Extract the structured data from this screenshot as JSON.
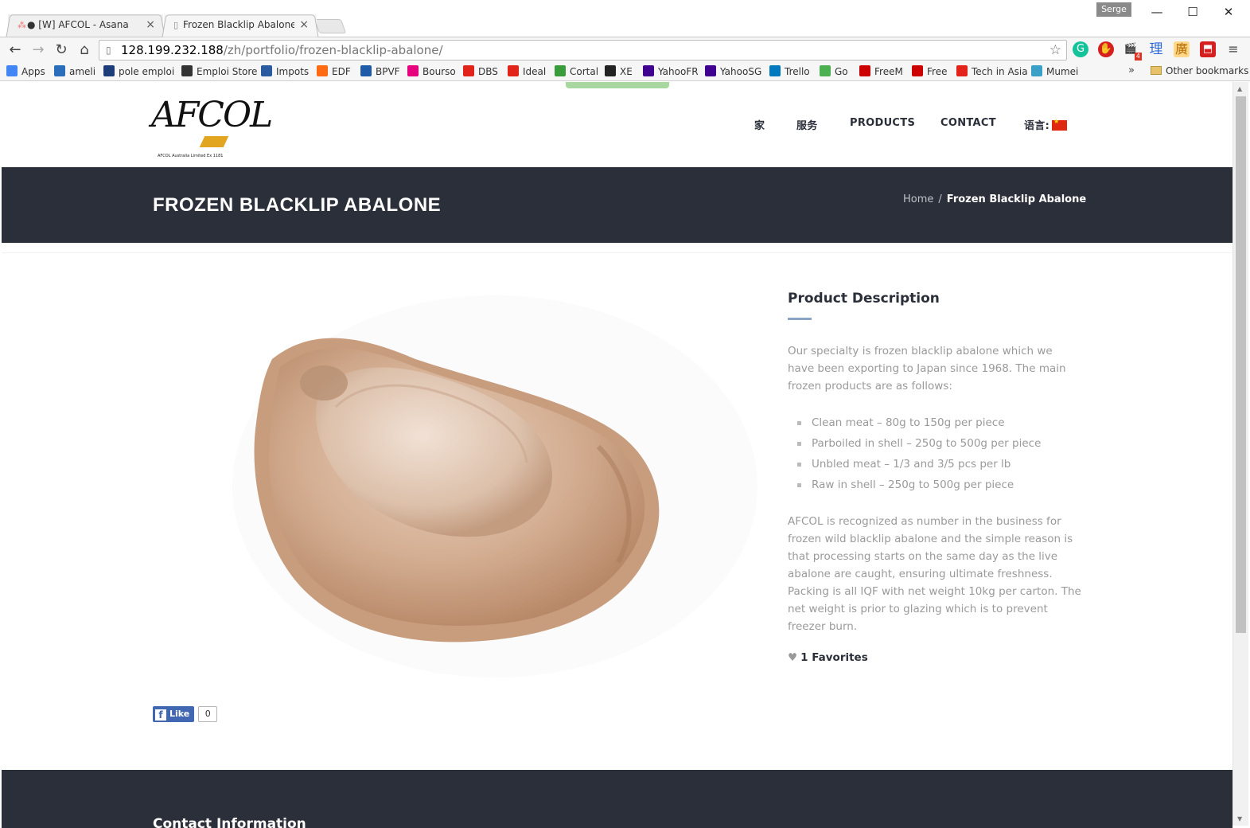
{
  "tabs": [
    {
      "title": "● [W] AFCOL - Asana",
      "icon": "asana-icon"
    },
    {
      "title": "Frozen Blacklip Abalone | A",
      "icon": "page-icon"
    }
  ],
  "window": {
    "profile": "Serge"
  },
  "address": {
    "host": "128.199.232.188",
    "path": "/zh/portfolio/frozen-blacklip-abalone/"
  },
  "extensions": {
    "clap_badge": "4",
    "li": "理",
    "guang": "廣"
  },
  "bookmarks": [
    {
      "label": "Apps",
      "color": "#4285f4"
    },
    {
      "label": "ameli",
      "color": "#2a6ebb"
    },
    {
      "label": "pole emploi",
      "color": "#1d3d7a"
    },
    {
      "label": "Emploi Store",
      "color": "#333333"
    },
    {
      "label": "Impots",
      "color": "#2a5aa0"
    },
    {
      "label": "EDF",
      "color": "#ff6a13"
    },
    {
      "label": "BPVF",
      "color": "#1e5aa8"
    },
    {
      "label": "Bourso",
      "color": "#e6007e"
    },
    {
      "label": "DBS",
      "color": "#e2231a"
    },
    {
      "label": "Ideal",
      "color": "#e2231a"
    },
    {
      "label": "Cortal",
      "color": "#3a9b3a"
    },
    {
      "label": "XE",
      "color": "#222222"
    },
    {
      "label": "YahooFR",
      "color": "#400090"
    },
    {
      "label": "YahooSG",
      "color": "#400090"
    },
    {
      "label": "Trello",
      "color": "#0079bf"
    },
    {
      "label": "Go",
      "color": "#4caf50"
    },
    {
      "label": "FreeM",
      "color": "#cc0000"
    },
    {
      "label": "Free",
      "color": "#cc0000"
    },
    {
      "label": "Tech in Asia",
      "color": "#e2231a"
    },
    {
      "label": "Mumei",
      "color": "#3aa0c8"
    }
  ],
  "bookmarks_more": "»",
  "other_bookmarks": "Other bookmarks",
  "site": {
    "logo_text": "AFCOL",
    "logo_tagline": "AFCOL Australia Limited    Ex 1181",
    "nav": {
      "home": "家",
      "services": "服务",
      "products": "PRODUCTS",
      "contact": "CONTACT",
      "language": "语言:"
    },
    "page_title": "FROZEN BLACKLIP ABALONE",
    "breadcrumb": {
      "home": "Home",
      "separator": "/",
      "current": "Frozen Blacklip Abalone"
    }
  },
  "product": {
    "heading": "Product Description",
    "intro": "Our specialty is frozen blacklip abalone which we have been exporting to Japan since 1968. The main frozen products are as follows:",
    "items": [
      "Clean meat – 80g to 150g per piece",
      "Parboiled in shell – 250g to 500g per piece",
      "Unbled meat – 1/3 and 3/5 pcs per lb",
      "Raw in shell – 250g to 500g per piece"
    ],
    "details": "AFCOL is recognized as number in the business for frozen wild blacklip abalone and the simple reason is that processing starts on the same day as the live abalone are caught, ensuring ultimate freshness. Packing is all IQF with net weight 10kg per carton. The net weight is prior to glazing which is to prevent freezer burn.",
    "favorites": "1 Favorites"
  },
  "facebook": {
    "label": "Like",
    "count": "0"
  },
  "footer": {
    "heading": "Contact Information"
  }
}
